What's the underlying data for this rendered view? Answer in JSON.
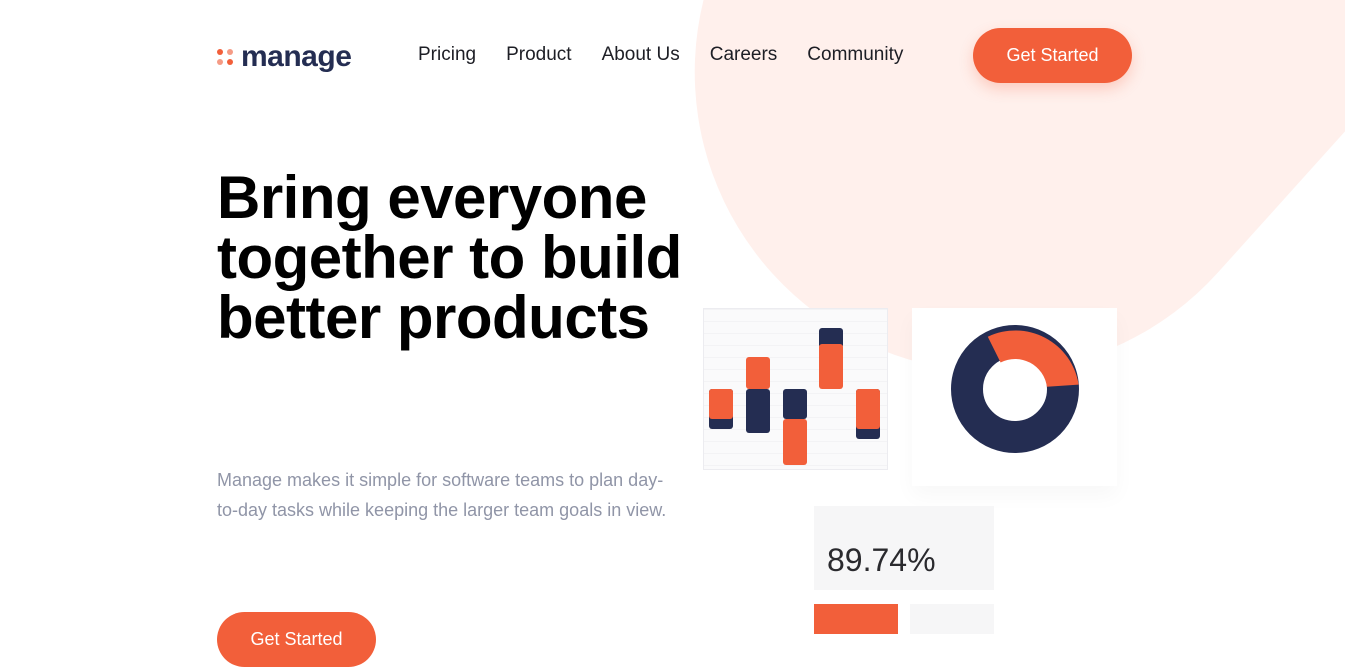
{
  "brand": {
    "name": "manage",
    "accent": "#f25f3a",
    "navy": "#242d52"
  },
  "nav": {
    "items": [
      "Pricing",
      "Product",
      "About Us",
      "Careers",
      "Community"
    ]
  },
  "header": {
    "cta_label": "Get Started"
  },
  "hero": {
    "title": "Bring everyone together to build better products",
    "description": "Manage makes it simple for software teams to plan day-to-day tasks while keeping the larger team goals in view.",
    "cta_label": "Get Started"
  },
  "stats": {
    "percent": "89.74%"
  },
  "chart_data": [
    {
      "type": "bar",
      "series": [
        {
          "values": [
            1,
            2,
            -1,
            2,
            -1
          ]
        },
        {
          "values": [
            1,
            1.5,
            1,
            0.5,
            0.3
          ]
        }
      ]
    },
    {
      "type": "pie",
      "values": [
        35,
        65
      ]
    }
  ]
}
